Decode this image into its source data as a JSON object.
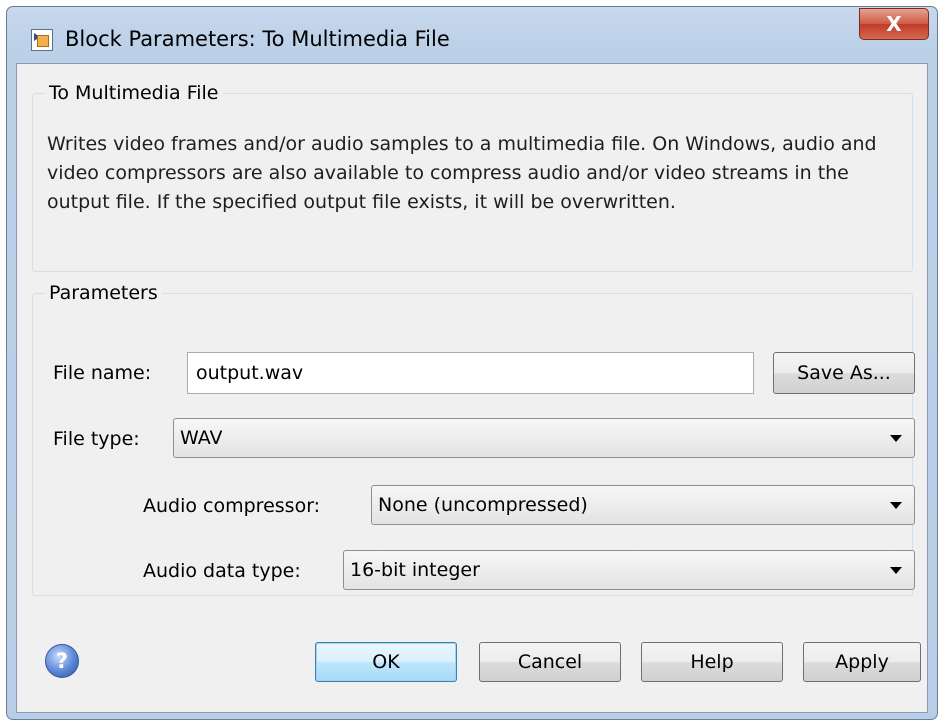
{
  "window": {
    "title": "Block Parameters: To Multimedia File",
    "close_glyph": "X"
  },
  "description_group": {
    "label": "To Multimedia File",
    "text": "Writes video frames and/or audio samples to a multimedia file. On Windows, audio and video compressors are also available to compress audio and/or video streams in the output file. If the specified output file exists, it will be overwritten."
  },
  "parameters": {
    "label": "Parameters",
    "file_name": {
      "label": "File name:",
      "value": "output.wav"
    },
    "save_as_label": "Save As...",
    "file_type": {
      "label": "File type:",
      "value": "WAV"
    },
    "audio_compressor": {
      "label": "Audio compressor:",
      "value": "None (uncompressed)"
    },
    "audio_data_type": {
      "label": "Audio data type:",
      "value": "16-bit integer"
    }
  },
  "buttons": {
    "ok": "OK",
    "cancel": "Cancel",
    "help": "Help",
    "apply": "Apply"
  },
  "icons": {
    "app": "block-parameters-icon",
    "help": "help-question-icon"
  }
}
